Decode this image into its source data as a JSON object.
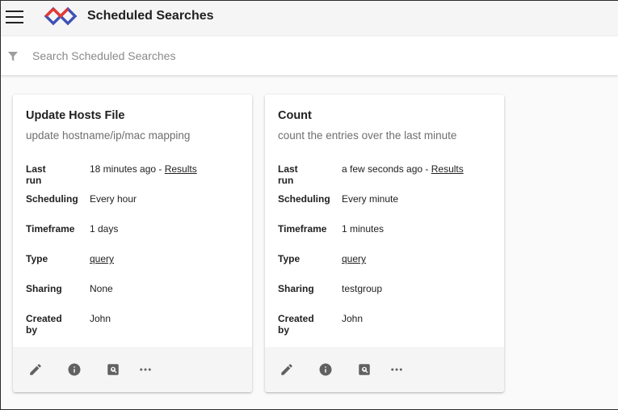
{
  "header": {
    "menu_icon": "hamburger-menu-icon",
    "logo_icon": "app-logo-icon",
    "title": "Scheduled Searches",
    "colors": {
      "logo_red": "#e53935",
      "logo_blue": "#3f51b5"
    }
  },
  "search": {
    "icon": "filter-icon",
    "placeholder": "Search Scheduled Searches",
    "value": ""
  },
  "cards": [
    {
      "title": "Update Hosts File",
      "subtitle": "update hostname/ip/mac mapping",
      "fields": {
        "last_run": {
          "label": "Last run",
          "value": "18 minutes ago - ",
          "link": "Results"
        },
        "scheduling": {
          "label": "Scheduling",
          "value": "Every hour"
        },
        "timeframe": {
          "label": "Timeframe",
          "value": "1 days"
        },
        "type": {
          "label": "Type",
          "value": "query"
        },
        "sharing": {
          "label": "Sharing",
          "value": "None"
        },
        "created_by": {
          "label": "Created by",
          "value": "John"
        }
      },
      "actions": [
        "edit-icon",
        "info-icon",
        "search-results-icon",
        "more-icon"
      ]
    },
    {
      "title": "Count",
      "subtitle": "count the entries over the last minute",
      "fields": {
        "last_run": {
          "label": "Last run",
          "value": "a few seconds ago - ",
          "link": "Results"
        },
        "scheduling": {
          "label": "Scheduling",
          "value": "Every minute"
        },
        "timeframe": {
          "label": "Timeframe",
          "value": "1 minutes"
        },
        "type": {
          "label": "Type",
          "value": "query"
        },
        "sharing": {
          "label": "Sharing",
          "value": "testgroup"
        },
        "created_by": {
          "label": "Created by",
          "value": "John"
        }
      },
      "actions": [
        "edit-icon",
        "info-icon",
        "search-results-icon",
        "more-icon"
      ]
    }
  ]
}
